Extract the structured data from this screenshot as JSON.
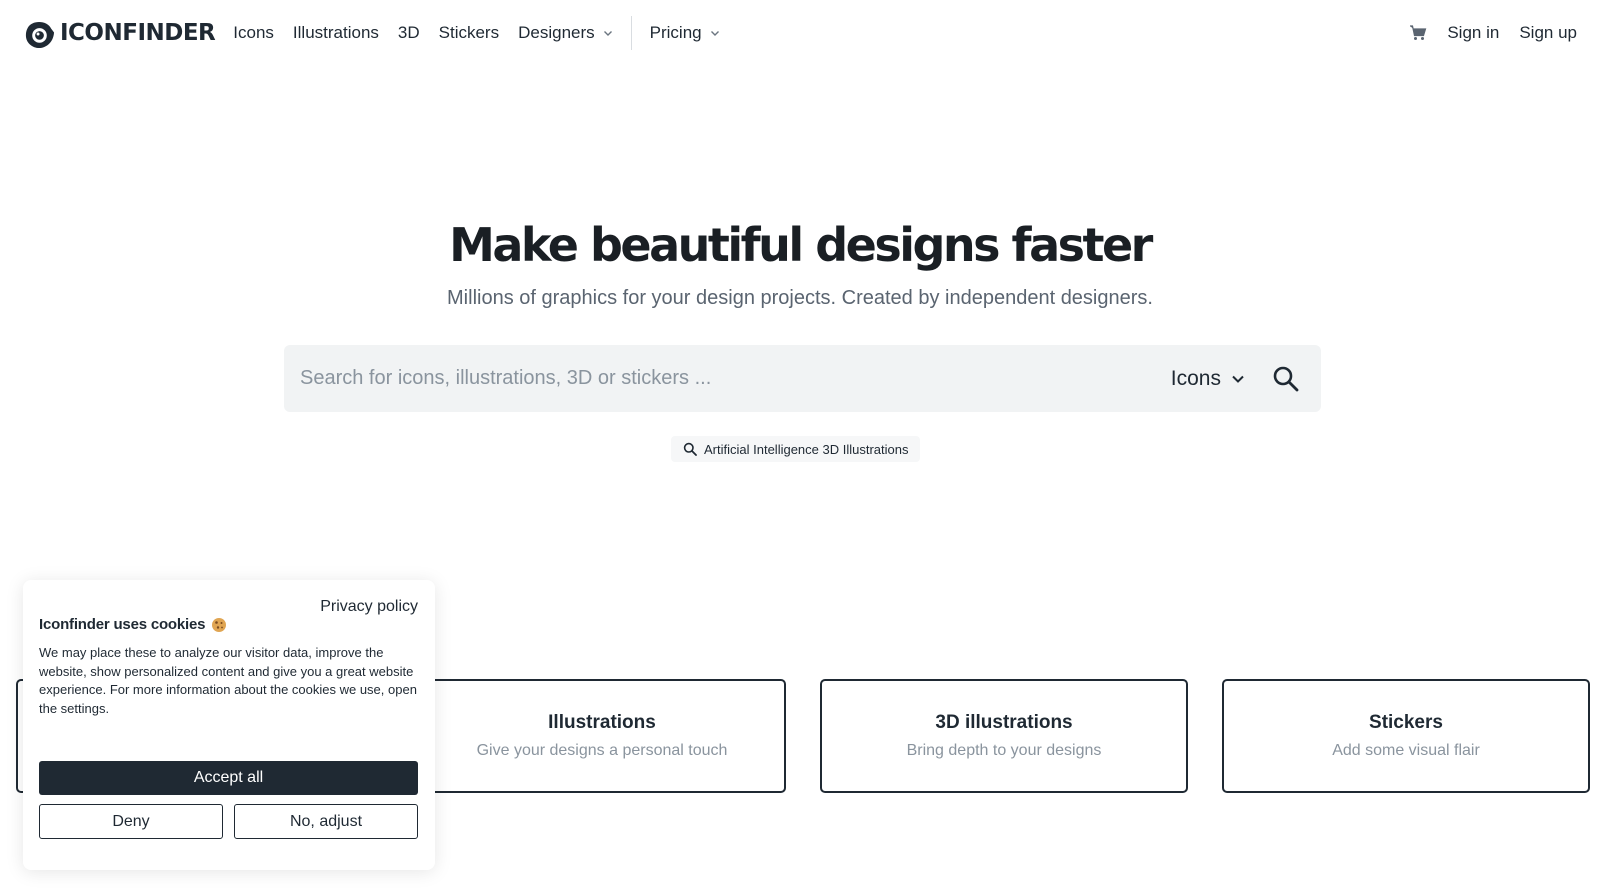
{
  "brand": {
    "name": "ICONFINDER"
  },
  "nav": {
    "items": [
      {
        "label": "Icons"
      },
      {
        "label": "Illustrations"
      },
      {
        "label": "3D"
      },
      {
        "label": "Stickers"
      },
      {
        "label": "Designers"
      },
      {
        "label": "Pricing"
      }
    ],
    "sign_in": "Sign in",
    "sign_up": "Sign up"
  },
  "hero": {
    "title_pre": "Make ",
    "title_highlight": "beautiful designs",
    "title_post": " faster",
    "subtitle": "Millions of graphics for your design projects. Created by independent designers.",
    "highlight_color": "#fbe3a8"
  },
  "search": {
    "placeholder": "Search for icons, illustrations, 3D or stickers ...",
    "value": "",
    "type_selected": "Icons",
    "suggestion": "Artificial Intelligence 3D Illustrations"
  },
  "categories": [
    {
      "title": "Illustrations",
      "subtitle": "Give your designs a personal touch"
    },
    {
      "title": "3D illustrations",
      "subtitle": "Bring depth to your designs"
    },
    {
      "title": "Stickers",
      "subtitle": "Add some visual flair"
    }
  ],
  "cookie": {
    "privacy_link": "Privacy policy",
    "title": "Iconfinder uses cookies",
    "text": "We may place these to analyze our visitor data, improve the website, show personalized content and give you a great website experience. For more information about the cookies we use, open the settings.",
    "accept": "Accept all",
    "deny": "Deny",
    "adjust": "No, adjust"
  },
  "colors": {
    "primary_dark": "#1f2933",
    "muted": "#8a949e",
    "search_bg": "#f1f3f4"
  }
}
